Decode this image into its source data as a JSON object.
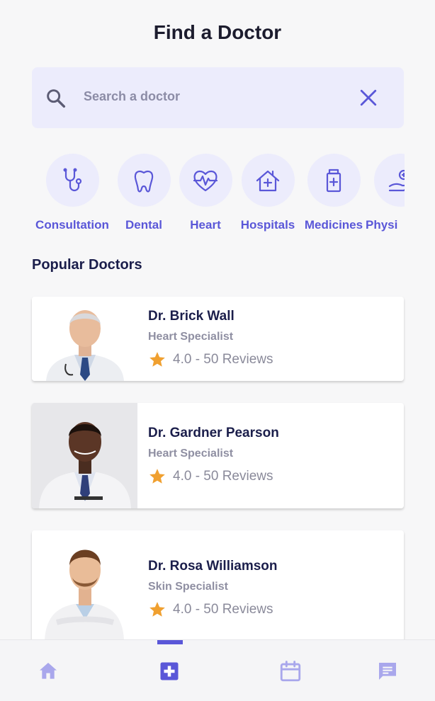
{
  "header": {
    "title": "Find a Doctor"
  },
  "search": {
    "placeholder": "Search a doctor",
    "value": ""
  },
  "categories": [
    {
      "label": "Consultation",
      "icon": "stethoscope-icon"
    },
    {
      "label": "Dental",
      "icon": "tooth-icon"
    },
    {
      "label": "Heart",
      "icon": "heart-pulse-icon"
    },
    {
      "label": "Hospitals",
      "icon": "hospital-house-icon"
    },
    {
      "label": "Medicines",
      "icon": "medicine-bottle-icon"
    },
    {
      "label": "Physi",
      "icon": "physio-hand-icon"
    }
  ],
  "section": {
    "popular_title": "Popular Doctors"
  },
  "doctors": [
    {
      "name": "Dr. Brick Wall",
      "specialty": "Heart Specialist",
      "rating": "4.0 - 50 Reviews"
    },
    {
      "name": "Dr. Gardner Pearson",
      "specialty": "Heart Specialist",
      "rating": "4.0 - 50 Reviews"
    },
    {
      "name": "Dr. Rosa Williamson",
      "specialty": "Skin Specialist",
      "rating": "4.0 - 50 Reviews"
    }
  ],
  "nav": {
    "items": [
      "home-icon",
      "medical-cross-icon",
      "calendar-icon",
      "chat-icon"
    ],
    "active_index": 1
  },
  "colors": {
    "accent": "#5a57d8",
    "accent_light": "#ececfc",
    "star": "#f0a030",
    "title": "#1b1e4b"
  }
}
